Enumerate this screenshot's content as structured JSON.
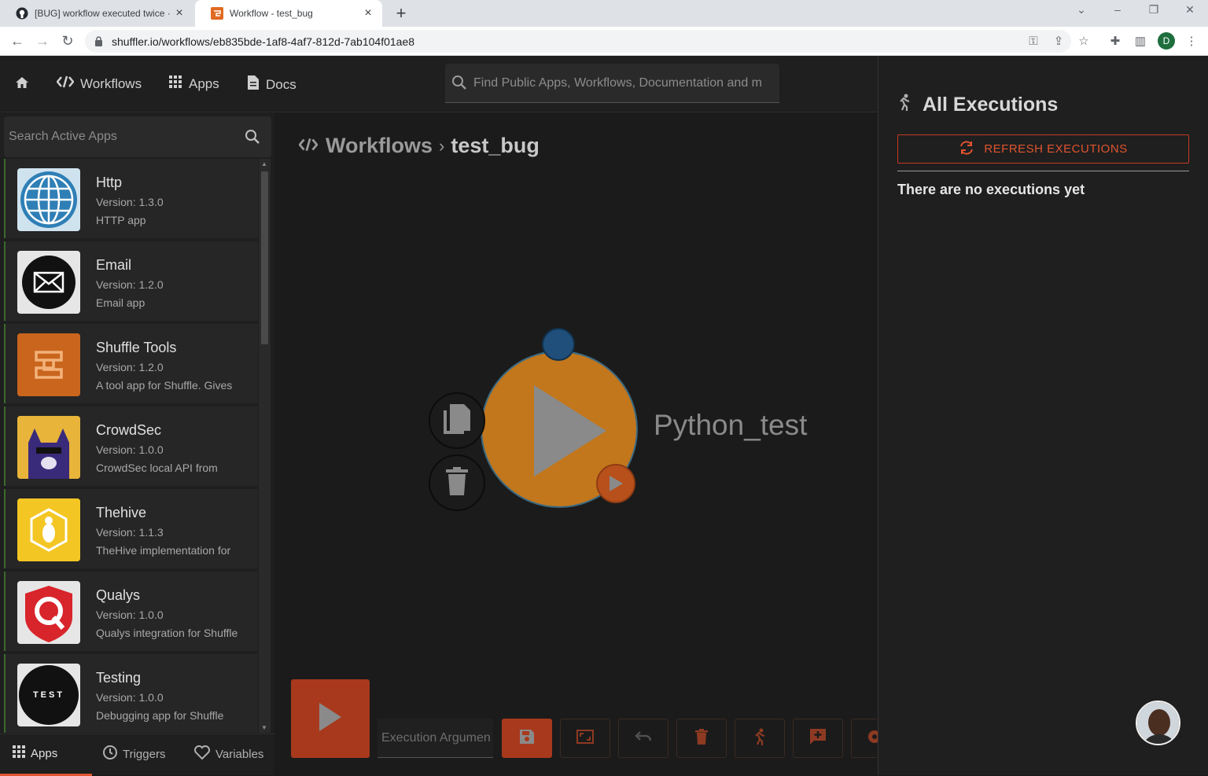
{
  "browser": {
    "tabs": [
      {
        "title": "[BUG] workflow executed twice ·",
        "icon": "github-icon",
        "active": false
      },
      {
        "title": "Workflow - test_bug",
        "icon": "shuffle-favicon",
        "active": true
      }
    ],
    "url": "shuffler.io/workflows/eb835bde-1af8-4af7-812d-7ab104f01ae8",
    "profile_initial": "D"
  },
  "topnav": {
    "items": [
      {
        "label": "Workflows",
        "icon": "workflows-icon"
      },
      {
        "label": "Apps",
        "icon": "apps-grid-icon"
      },
      {
        "label": "Docs",
        "icon": "docs-icon"
      }
    ],
    "search_placeholder": "Find Public Apps, Workflows, Documentation and m"
  },
  "leftpanel": {
    "search_placeholder": "Search Active Apps",
    "apps": [
      {
        "name": "Http",
        "version": "Version: 1.3.0",
        "description": "HTTP app"
      },
      {
        "name": "Email",
        "version": "Version: 1.2.0",
        "description": "Email app"
      },
      {
        "name": "Shuffle Tools",
        "version": "Version: 1.2.0",
        "description": "A tool app for Shuffle. Gives"
      },
      {
        "name": "CrowdSec",
        "version": "Version: 1.0.0",
        "description": "CrowdSec local API from"
      },
      {
        "name": "Thehive",
        "version": "Version: 1.1.3",
        "description": "TheHive implementation for"
      },
      {
        "name": "Qualys",
        "version": "Version: 1.0.0",
        "description": "Qualys integration for Shuffle"
      },
      {
        "name": "Testing",
        "version": "Version: 1.0.0",
        "description": "Debugging app for Shuffle"
      }
    ],
    "bottom_tabs": [
      {
        "label": "Apps",
        "icon": "apps-grid-icon",
        "active": true
      },
      {
        "label": "Triggers",
        "icon": "clock-icon",
        "active": false
      },
      {
        "label": "Variables",
        "icon": "heart-icon",
        "active": false
      }
    ],
    "testing_logo_text": "TEST"
  },
  "canvas": {
    "breadcrumb": {
      "root": "Workflows",
      "separator": "›",
      "current": "test_bug"
    },
    "node_label": "Python_test",
    "execution_argument_placeholder": "Execution Argumen"
  },
  "rightpanel": {
    "title": "All Executions",
    "refresh_label": "REFRESH EXECUTIONS",
    "empty_message": "There are no executions yet"
  },
  "colors": {
    "accent": "#e0542f",
    "node_orange": "#c2771c",
    "run_button": "#a8391d"
  }
}
